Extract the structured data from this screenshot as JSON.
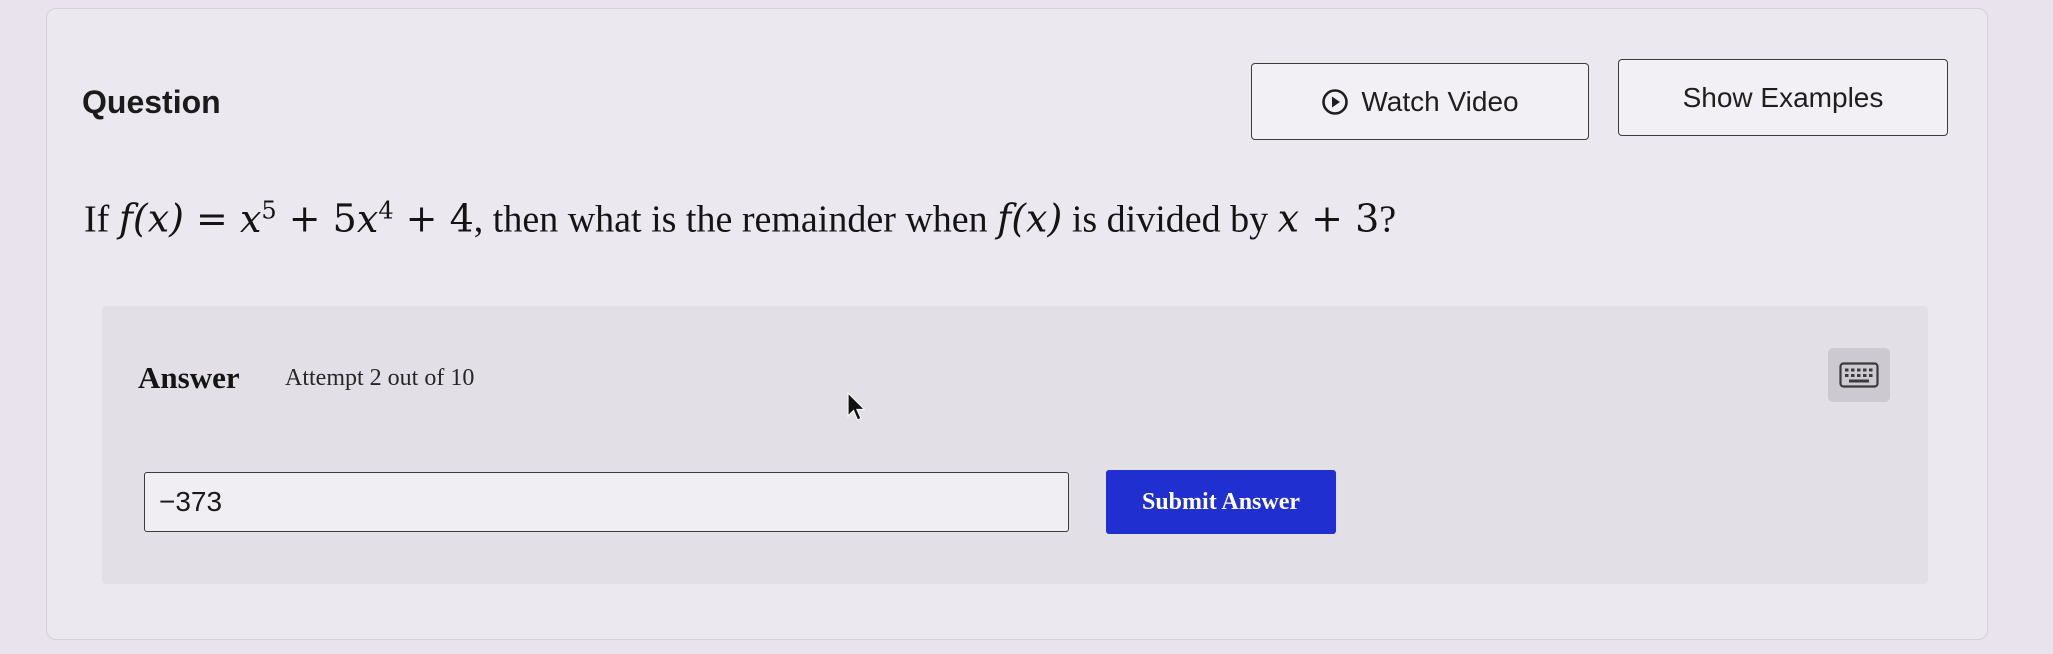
{
  "question": {
    "label": "Question",
    "text_prefix": "If ",
    "f_of_x_1": "f(x)",
    "equals": " = ",
    "x_base_1": "x",
    "exp_5": "5",
    "plus_1": " + 5",
    "x_base_2": "x",
    "exp_4": "4",
    "plus_2": " + 4",
    "text_middle": ", then what is the remainder when ",
    "f_of_x_2": "f(x)",
    "text_divided": " is divided by ",
    "x_base_3": "x",
    "plus_3": " + 3",
    "text_end": "?"
  },
  "buttons": {
    "watch_video": "Watch Video",
    "show_examples": "Show Examples"
  },
  "answer": {
    "label": "Answer",
    "attempt": "Attempt 2 out of 10",
    "input_value": "−373",
    "submit_label": "Submit Answer"
  },
  "colors": {
    "submit_bg": "#1f2fd0",
    "page_bg": "#e9e3ee",
    "panel_bg": "#e3dfe6"
  },
  "icons": {
    "watch_video": "play-circle-icon",
    "keyboard": "keyboard-icon",
    "cursor": "mouse-pointer-icon"
  }
}
